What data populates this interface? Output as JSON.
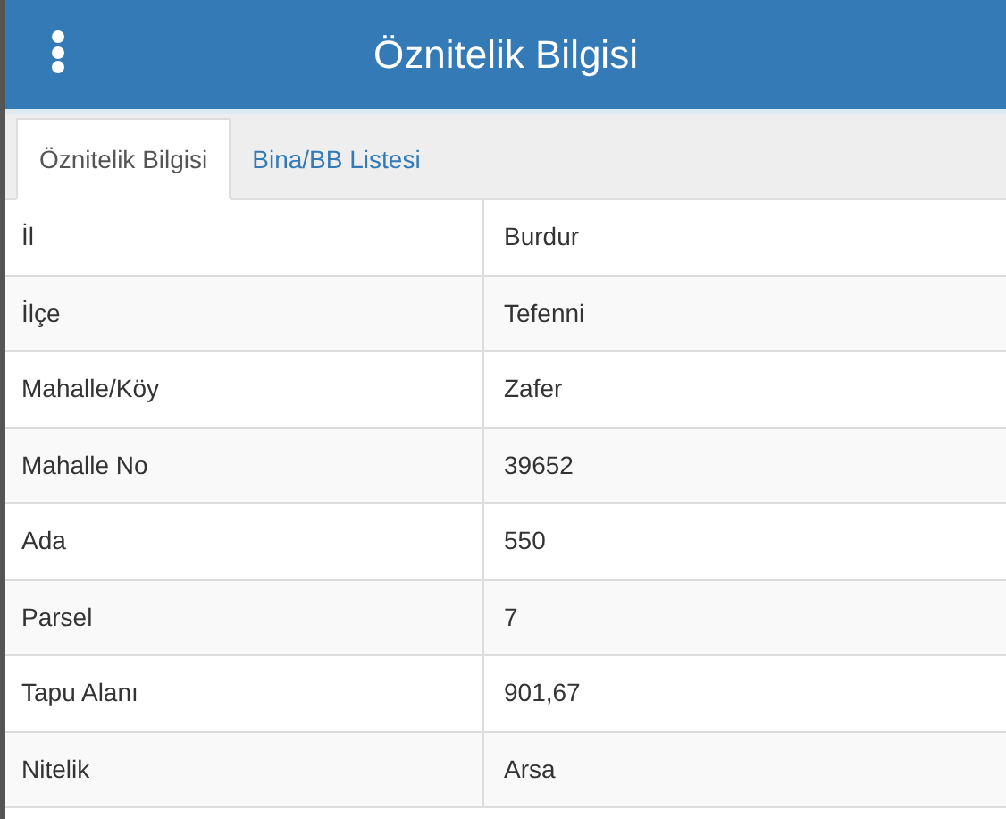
{
  "header": {
    "title": "Öznitelik Bilgisi"
  },
  "tabs": [
    {
      "label": "Öznitelik Bilgisi",
      "selected": true
    },
    {
      "label": "Bina/BB Listesi",
      "selected": false
    }
  ],
  "table": {
    "rows": [
      {
        "label": "İl",
        "value": "Burdur"
      },
      {
        "label": "İlçe",
        "value": "Tefenni"
      },
      {
        "label": "Mahalle/Köy",
        "value": "Zafer"
      },
      {
        "label": "Mahalle No",
        "value": "39652"
      },
      {
        "label": "Ada",
        "value": "550"
      },
      {
        "label": "Parsel",
        "value": "7"
      },
      {
        "label": "Tapu Alanı",
        "value": "901,67"
      },
      {
        "label": "Nitelik",
        "value": "Arsa"
      }
    ]
  }
}
